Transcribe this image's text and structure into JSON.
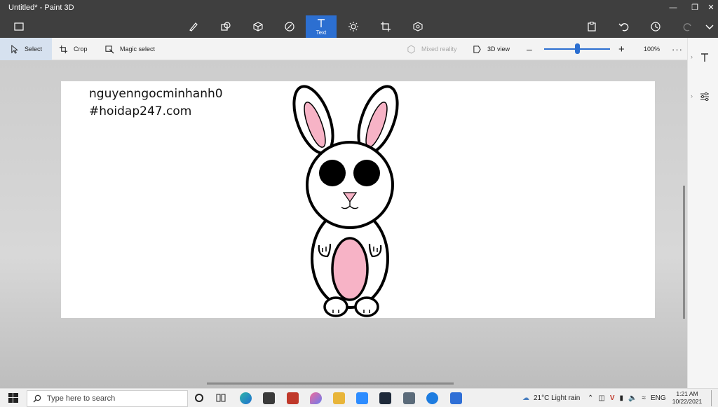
{
  "app": {
    "title": "Untitled* - Paint 3D"
  },
  "toolbar": {
    "active_tool_label": "Text"
  },
  "subbar": {
    "select_label": "Select",
    "crop_label": "Crop",
    "magic_select_label": "Magic select",
    "mixed_reality_label": "Mixed reality",
    "view_3d_label": "3D view",
    "zoom_label": "100%",
    "zoom_fraction": 0.5
  },
  "canvas": {
    "line1": "nguyenngocminhanh0",
    "line2": "#hoidap247.com"
  },
  "taskbar": {
    "search_placeholder": "Type here to search",
    "weather": "21°C  Light rain",
    "language": "ENG",
    "time": "1:21 AM",
    "date": "10/22/2021"
  },
  "colors": {
    "accent": "#2c6fd1",
    "bunny_pink": "#f7b3c6"
  }
}
